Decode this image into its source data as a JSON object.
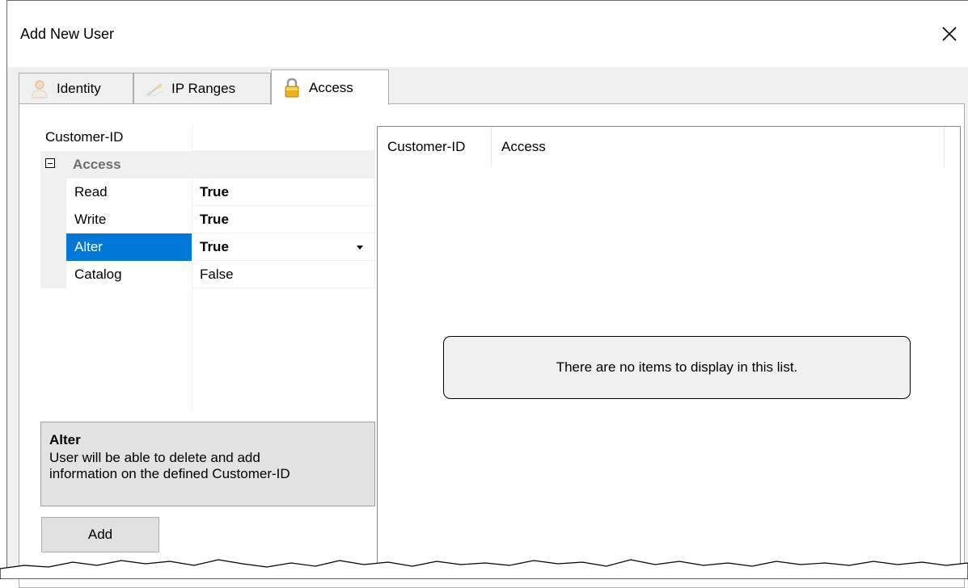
{
  "window": {
    "title": "Add New User"
  },
  "tabs": [
    {
      "label": "Identity",
      "icon": "person-icon",
      "active": false
    },
    {
      "label": "IP Ranges",
      "icon": "network-icon",
      "active": false
    },
    {
      "label": "Access",
      "icon": "lock-icon",
      "active": true
    }
  ],
  "property_grid": {
    "top_property": {
      "name": "Customer-ID",
      "value": ""
    },
    "category": {
      "name": "Access",
      "expanded": true
    },
    "properties": [
      {
        "name": "Read",
        "value": "True",
        "bold": true,
        "selected": false
      },
      {
        "name": "Write",
        "value": "True",
        "bold": true,
        "selected": false
      },
      {
        "name": "Alter",
        "value": "True",
        "bold": true,
        "selected": true
      },
      {
        "name": "Catalog",
        "value": "False",
        "bold": false,
        "selected": false
      }
    ]
  },
  "help_panel": {
    "title": "Alter",
    "description": "User will be able to delete and add information on the defined Customer-ID"
  },
  "buttons": {
    "add_label": "Add"
  },
  "list_view": {
    "columns": [
      "Customer-ID",
      "Access"
    ],
    "empty_message": "There are no items to display in this list."
  },
  "colors": {
    "selection": "#0078d7",
    "tab_active_bg": "#ffffff",
    "dialog_bg": "#f0f0f0"
  }
}
